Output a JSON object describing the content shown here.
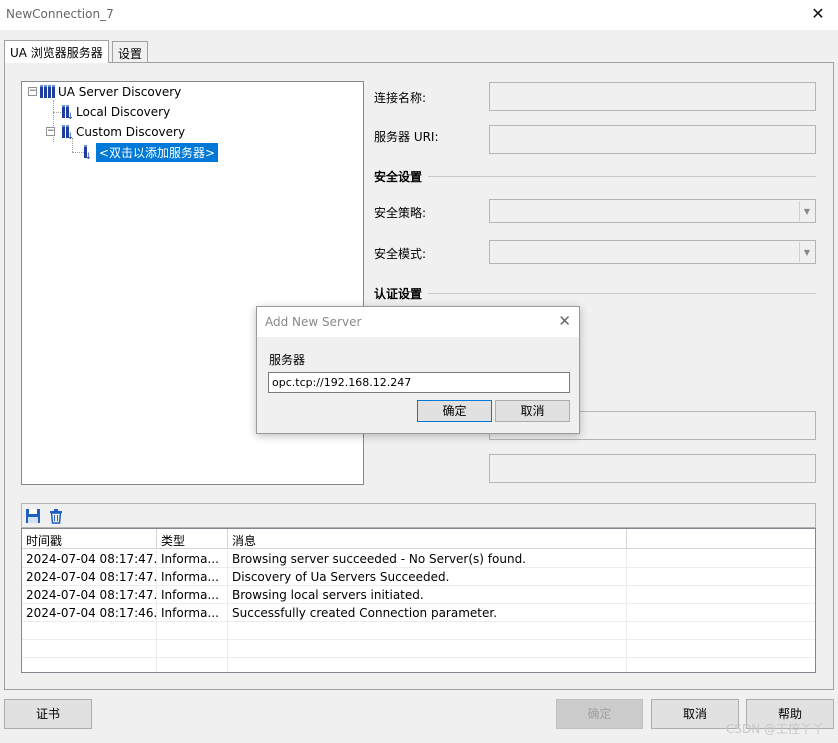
{
  "window": {
    "title": "NewConnection_7",
    "close_glyph": "✕"
  },
  "tabs": [
    {
      "label": "UA 浏览器服务器",
      "active": true
    },
    {
      "label": "设置",
      "active": false
    }
  ],
  "tree": {
    "root": {
      "label": "UA Server Discovery",
      "expander": "⊟"
    },
    "children": [
      {
        "label": "Local Discovery"
      },
      {
        "label": "Custom Discovery",
        "expander": "⊟"
      }
    ],
    "leaf": {
      "label": "<双击以添加服务器>",
      "selected": true
    }
  },
  "form": {
    "connection_name_label": "连接名称:",
    "server_uri_label": "服务器 URI:",
    "security_section": "安全设置",
    "security_policy_label": "安全策略:",
    "security_mode_label": "安全模式:",
    "auth_section": "认证设置"
  },
  "log": {
    "toolbar_icons": [
      "save-icon",
      "delete-icon"
    ],
    "columns": [
      "时间戳",
      "类型",
      "消息"
    ],
    "rows": [
      {
        "time": "2024-07-04 08:17:47...",
        "type": "Informa...",
        "msg": "Browsing server succeeded - No Server(s) found."
      },
      {
        "time": "2024-07-04 08:17:47...",
        "type": "Informa...",
        "msg": "Discovery of Ua Servers Succeeded."
      },
      {
        "time": "2024-07-04 08:17:47...",
        "type": "Informa...",
        "msg": "Browsing local servers initiated."
      },
      {
        "time": "2024-07-04 08:17:46...",
        "type": "Informa...",
        "msg": "Successfully created Connection parameter."
      }
    ]
  },
  "buttons": {
    "certificate": "证书",
    "ok": "确定",
    "cancel": "取消",
    "help": "帮助"
  },
  "dialog": {
    "title": "Add New Server",
    "close_glyph": "✕",
    "field_label": "服务器",
    "input_value": "opc.tcp://192.168.12.247",
    "ok": "确定",
    "cancel": "取消"
  },
  "watermark": "CSDN @工控丫丫",
  "colors": {
    "selection": "#0078d7",
    "icon_blue": "#1f3f9f"
  }
}
